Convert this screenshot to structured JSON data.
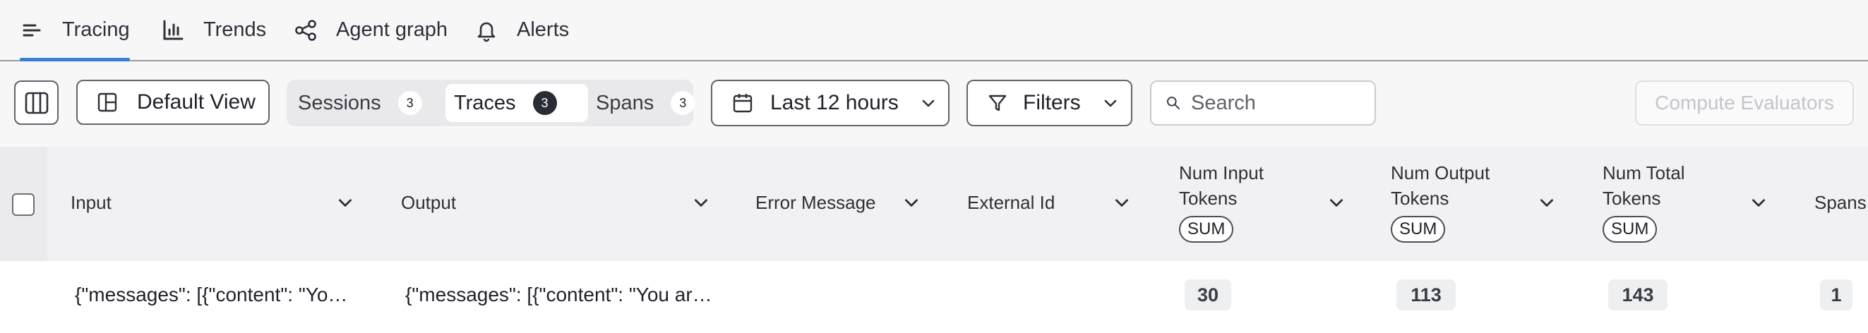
{
  "nav": {
    "tabs": [
      {
        "label": "Tracing",
        "icon": "list-lines-icon",
        "active": true
      },
      {
        "label": "Trends",
        "icon": "bar-chart-icon",
        "active": false
      },
      {
        "label": "Agent graph",
        "icon": "graph-nodes-icon",
        "active": false
      },
      {
        "label": "Alerts",
        "icon": "bell-icon",
        "active": false
      }
    ],
    "accent_color": "#3a7cde"
  },
  "toolbar": {
    "view_label": "Default View",
    "segments": [
      {
        "label": "Sessions",
        "count": "3",
        "active": false
      },
      {
        "label": "Traces",
        "count": "3",
        "active": true
      },
      {
        "label": "Spans",
        "count": "3",
        "active": false
      }
    ],
    "time_range": "Last 12 hours",
    "filters_label": "Filters",
    "search_placeholder": "Search",
    "compute_label": "Compute Evaluators"
  },
  "table": {
    "columns": [
      {
        "label": "Input"
      },
      {
        "label": "Output"
      },
      {
        "label": "Error Message"
      },
      {
        "label": "External Id"
      },
      {
        "label_line1": "Num Input",
        "label_line2": "Tokens",
        "badge": "SUM"
      },
      {
        "label_line1": "Num Output",
        "label_line2": "Tokens",
        "badge": "SUM"
      },
      {
        "label_line1": "Num Total",
        "label_line2": "Tokens",
        "badge": "SUM"
      },
      {
        "label": "Spans"
      }
    ],
    "rows": [
      {
        "input": "{\"messages\": [{\"content\": \"Yo…",
        "output": "{\"messages\": [{\"content\": \"You ar…",
        "error_message": "",
        "external_id": "",
        "num_input_tokens": "30",
        "num_output_tokens": "113",
        "num_total_tokens": "143",
        "spans": "1"
      }
    ]
  }
}
